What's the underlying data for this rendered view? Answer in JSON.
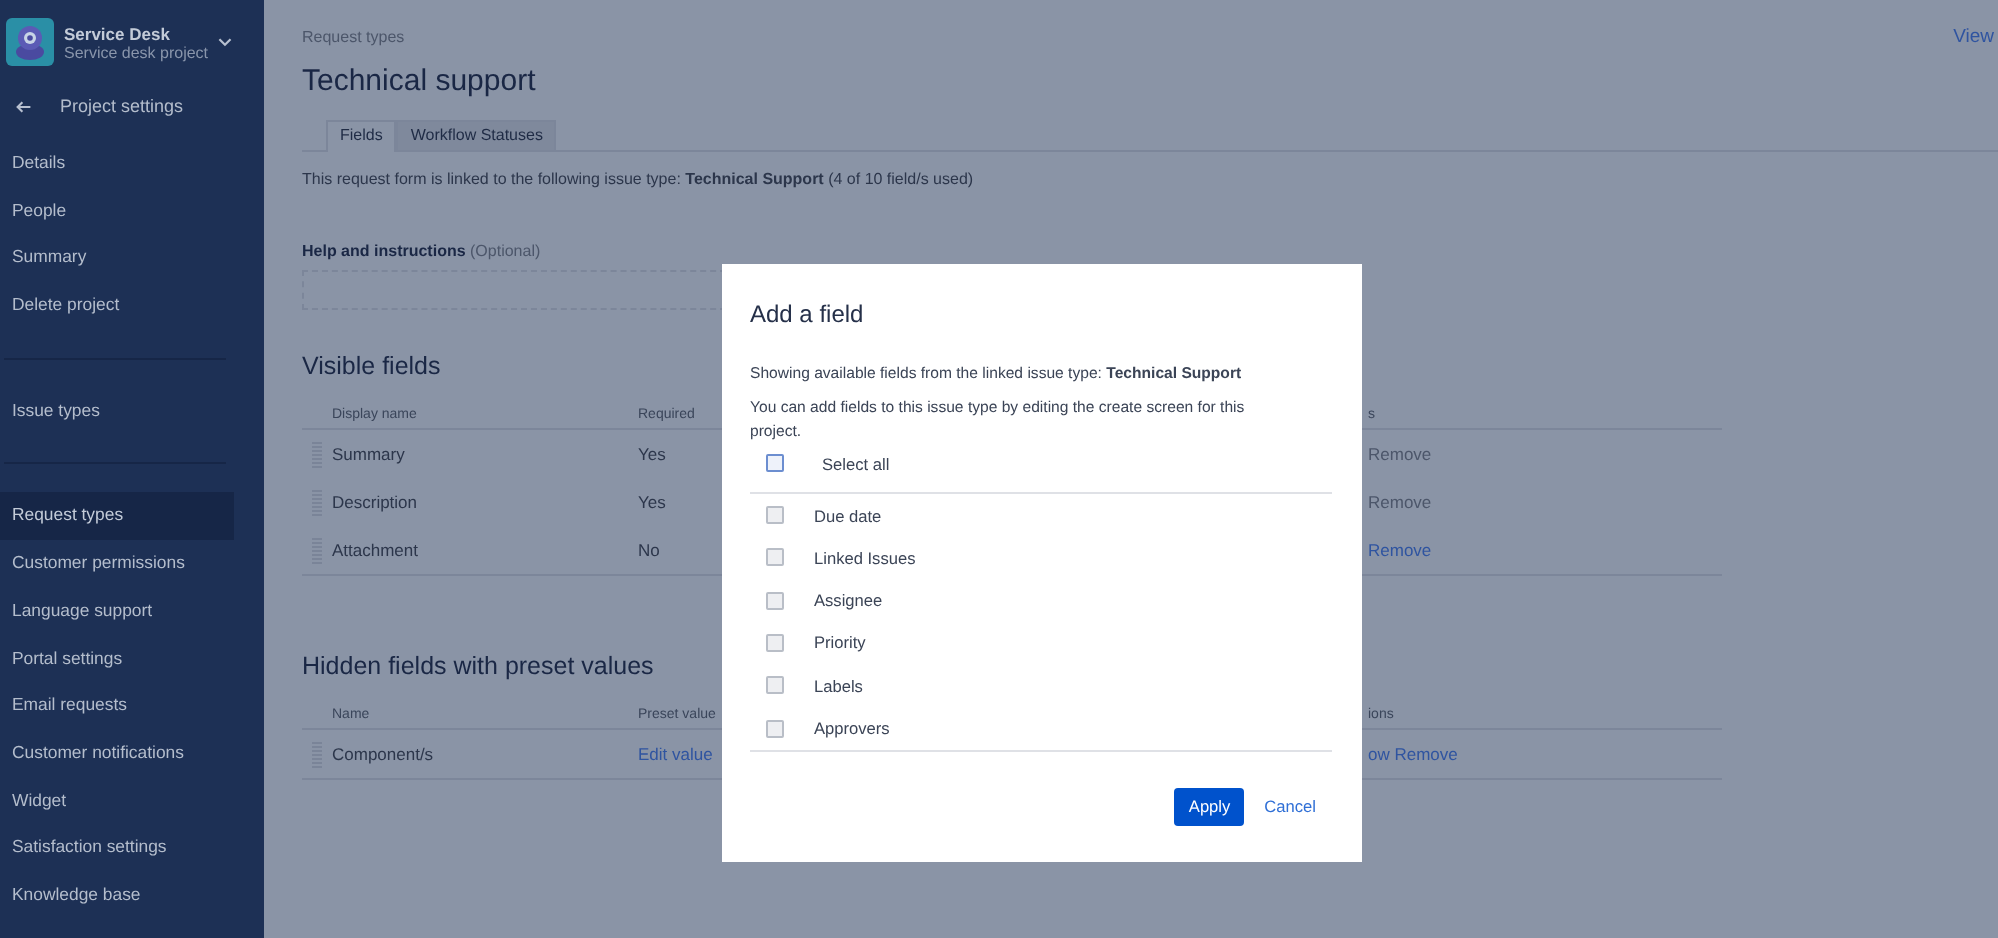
{
  "sidebar": {
    "project": {
      "name": "Service Desk",
      "type": "Service desk project"
    },
    "back_label": "Project settings",
    "groups": [
      {
        "items": [
          {
            "label": "Details",
            "selected": false
          },
          {
            "label": "People",
            "selected": false
          },
          {
            "label": "Summary",
            "selected": false
          },
          {
            "label": "Delete project",
            "selected": false
          }
        ]
      },
      {
        "items": [
          {
            "label": "Issue types",
            "selected": false
          }
        ]
      },
      {
        "items": [
          {
            "label": "Request types",
            "selected": true
          },
          {
            "label": "Customer permissions",
            "selected": false
          },
          {
            "label": "Language support",
            "selected": false
          },
          {
            "label": "Portal settings",
            "selected": false
          },
          {
            "label": "Email requests",
            "selected": false
          },
          {
            "label": "Customer notifications",
            "selected": false
          },
          {
            "label": "Widget",
            "selected": false
          },
          {
            "label": "Satisfaction settings",
            "selected": false
          },
          {
            "label": "Knowledge base",
            "selected": false
          }
        ]
      }
    ]
  },
  "page": {
    "breadcrumb": "Request types",
    "title": "Technical support",
    "view_link": "View",
    "tabs": [
      {
        "label": "Fields",
        "selected": true
      },
      {
        "label": "Workflow Statuses",
        "selected": false
      }
    ],
    "linked_text": "This request form is linked to the following issue type: **Technical Support** (4 of 10 field/s used)",
    "help_label": "**Help and instructions** (Optional)",
    "visible_fields": {
      "heading": "Visible fields",
      "columns": [
        "Display name",
        "Required",
        "s"
      ],
      "rows": [
        {
          "name": "Summary",
          "required": "Yes",
          "action": "Remove",
          "removable": false
        },
        {
          "name": "Description",
          "required": "Yes",
          "action": "Remove",
          "removable": false
        },
        {
          "name": "Attachment",
          "required": "No",
          "action": "Remove",
          "removable": true
        }
      ]
    },
    "hidden_fields": {
      "heading": "Hidden fields with preset values",
      "columns": [
        "Name",
        "Preset value",
        "ions"
      ],
      "rows": [
        {
          "name": "Component/s",
          "preset_value": "Edit value",
          "action": "ow Remove",
          "removable": true
        }
      ]
    }
  },
  "dialog": {
    "title": "Add a field",
    "intro": "Showing available fields from the linked issue type: **Technical Support**",
    "note": "You can add fields to this issue type by editing the create screen for this project.",
    "select_all": {
      "label": "Select all",
      "checked": false
    },
    "fields": [
      {
        "label": "Due date",
        "checked": false
      },
      {
        "label": "Linked Issues",
        "checked": false
      },
      {
        "label": "Assignee",
        "checked": false
      },
      {
        "label": "Priority",
        "checked": false
      },
      {
        "label": "Labels",
        "checked": false
      },
      {
        "label": "Approvers",
        "checked": false
      }
    ],
    "apply": "Apply",
    "cancel": "Cancel"
  }
}
